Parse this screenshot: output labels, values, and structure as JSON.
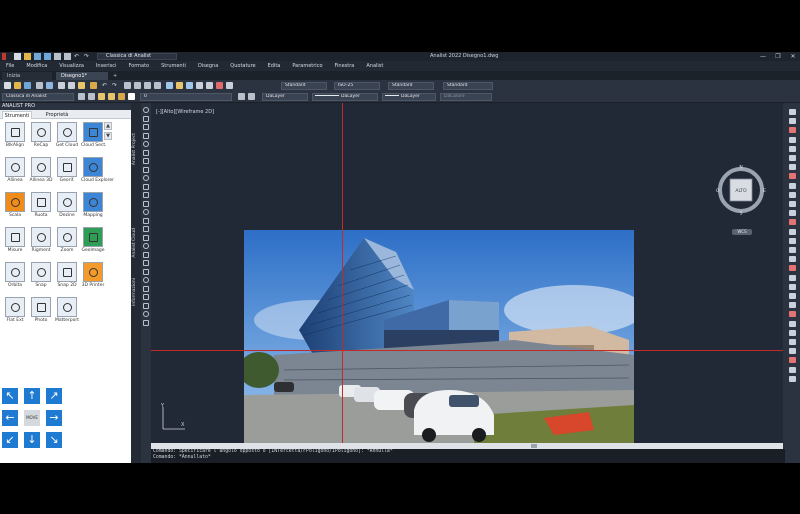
{
  "window": {
    "title": "Analist 2022  Disegno1.dwg",
    "workspace": "Classica di Analist",
    "controls": [
      "—",
      "❐",
      "✕"
    ]
  },
  "menubar": [
    "File",
    "Modifica",
    "Visualizza",
    "Inserisci",
    "Formato",
    "Strumenti",
    "Disegna",
    "Quotature",
    "Edita",
    "Parametrico",
    "Finestra",
    "Analist"
  ],
  "tabs": {
    "start": "Inizia",
    "drawing": "Disegno1*",
    "add": "+"
  },
  "toolbar": {
    "text_style": "Standard",
    "dim_style": "ISO-25",
    "table_style": "Standard",
    "multileader_style": "Standard",
    "workspace_combo": "Classica di Analist",
    "layer_value": "0",
    "color": "DaLayer",
    "linetype": "DaLayer",
    "lineweight": "DaLayer",
    "plot_style": "DaColore"
  },
  "panel": {
    "title": "ANALIST PRO",
    "tabs": [
      "Strumenti",
      "Proprietà"
    ],
    "tools": [
      {
        "label": "BlkAlign",
        "icon": "blockalign-icon"
      },
      {
        "label": "ReCap",
        "icon": "recap-icon"
      },
      {
        "label": "Get Cloud",
        "icon": "get-cloud-icon"
      },
      {
        "label": "Cloud Sect.",
        "icon": "cloud-section-icon"
      },
      {
        "label": "Allinea",
        "icon": "align-icon"
      },
      {
        "label": "Allinea 3D",
        "icon": "align3d-icon"
      },
      {
        "label": "Georif.",
        "icon": "georef-icon"
      },
      {
        "label": "Cloud Explorer",
        "icon": "cloud-explorer-icon"
      },
      {
        "label": "Scala",
        "icon": "scale-icon"
      },
      {
        "label": "Ruota",
        "icon": "rotate-icon"
      },
      {
        "label": "Dezine",
        "icon": "dezine-icon"
      },
      {
        "label": "Mapping",
        "icon": "mapping-icon"
      },
      {
        "label": "Misure",
        "icon": "measure-icon"
      },
      {
        "label": "Rigment",
        "icon": "rigment-icon"
      },
      {
        "label": "Zoom",
        "icon": "zoom-icon"
      },
      {
        "label": "Geolmage",
        "icon": "geoimage-icon"
      },
      {
        "label": "Orbita",
        "icon": "orbit-icon"
      },
      {
        "label": "Snap",
        "icon": "snap-icon"
      },
      {
        "label": "Snap 2D",
        "icon": "snap2d-icon"
      },
      {
        "label": "3D Printer",
        "icon": "printer3d-icon"
      },
      {
        "label": "Flat Ext",
        "icon": "flat-ext-icon"
      },
      {
        "label": "Photo",
        "icon": "photo-icon"
      },
      {
        "label": "Matterport",
        "icon": "matterport-icon"
      }
    ],
    "move_label": "MOVE"
  },
  "side_labels": [
    "Analist Project",
    "Analist Cloud",
    "Informazioni"
  ],
  "canvas": {
    "view_label": "[-][Alto][Wireframe 2D]",
    "viewcube": {
      "center": "ALTO",
      "n": "N",
      "s": "S",
      "e": "E",
      "w": "O",
      "ucs": "WCS"
    },
    "ucs_y": "Y",
    "ucs_x": "X"
  },
  "command": {
    "line1": "Comando: Specificare l'angolo opposto o [INTercetta/FPoligono/IPoligono]: *Annulla*",
    "line2": "Comando: *Annullato*"
  }
}
